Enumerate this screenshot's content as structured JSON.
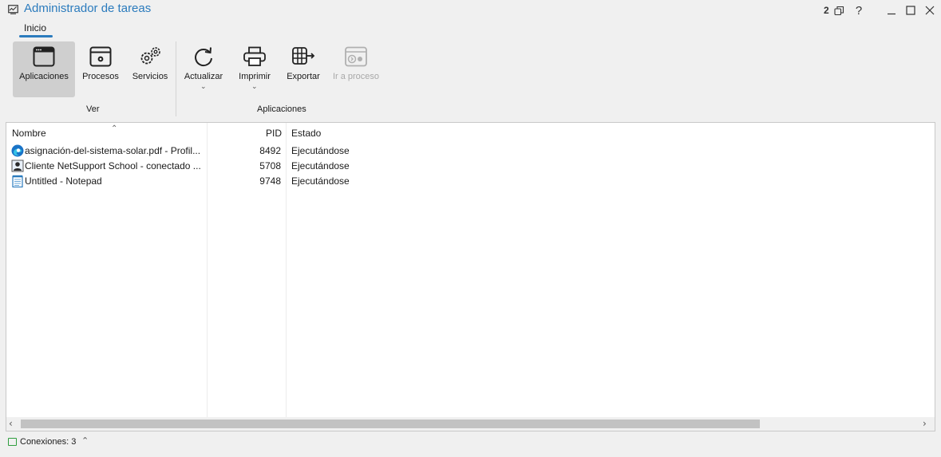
{
  "window": {
    "title": "Administrador de tareas",
    "instance_count": "2",
    "help": "?"
  },
  "ribbon": {
    "tab": "Inicio",
    "buttons": {
      "apps": "Aplicaciones",
      "procs": "Procesos",
      "services": "Servicios",
      "refresh": "Actualizar",
      "print": "Imprimir",
      "export": "Exportar",
      "goto": "Ir a proceso"
    },
    "groups": {
      "view": "Ver",
      "apps": "Aplicaciones"
    }
  },
  "table": {
    "headers": {
      "name": "Nombre",
      "pid": "PID",
      "state": "Estado"
    },
    "rows": [
      {
        "name": "asignación-del-sistema-solar.pdf - Profil...",
        "pid": "8492",
        "state": "Ejecutándose",
        "icon": "edge-icon"
      },
      {
        "name": "Cliente NetSupport School - conectado ...",
        "pid": "5708",
        "state": "Ejecutándose",
        "icon": "netsupport-icon"
      },
      {
        "name": "Untitled - Notepad",
        "pid": "9748",
        "state": "Ejecutándose",
        "icon": "notepad-icon"
      }
    ]
  },
  "status": {
    "connections": "Conexiones: 3"
  },
  "colors": {
    "accent": "#2b7bbd",
    "connection": "#2e9e3e"
  }
}
